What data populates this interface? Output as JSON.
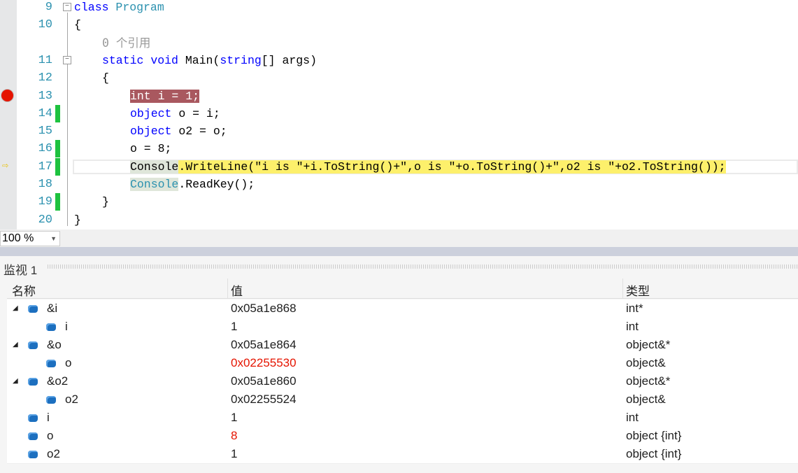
{
  "editor": {
    "lines": [
      {
        "num": "9",
        "tokens": [
          {
            "t": "class ",
            "c": "kw"
          },
          {
            "t": "Program",
            "c": "ty"
          }
        ],
        "indent": 1,
        "fold": true
      },
      {
        "num": "10",
        "tokens": [
          {
            "t": "{"
          }
        ],
        "indent": 1
      },
      {
        "num": "",
        "tokens": [
          {
            "t": "0 个引用",
            "c": "cl"
          }
        ],
        "indent": 2
      },
      {
        "num": "11",
        "tokens": [
          {
            "t": "static ",
            "c": "kw"
          },
          {
            "t": "void ",
            "c": "kw"
          },
          {
            "t": "Main("
          },
          {
            "t": "string",
            "c": "kw"
          },
          {
            "t": "[] args)"
          }
        ],
        "indent": 2,
        "fold": true
      },
      {
        "num": "12",
        "tokens": [
          {
            "t": "{"
          }
        ],
        "indent": 2
      },
      {
        "num": "13",
        "tokens": [
          {
            "t": "int i = 1;",
            "c": "hl-bp"
          }
        ],
        "indent": 3,
        "breakpoint": true
      },
      {
        "num": "14",
        "tokens": [
          {
            "t": "object",
            "c": "kw"
          },
          {
            "t": " o = i;"
          }
        ],
        "indent": 3,
        "changed": true
      },
      {
        "num": "15",
        "tokens": [
          {
            "t": "object",
            "c": "kw"
          },
          {
            "t": " o2 = o;"
          }
        ],
        "indent": 3
      },
      {
        "num": "16",
        "tokens": [
          {
            "t": "o = 8;"
          }
        ],
        "indent": 3,
        "changed": true
      },
      {
        "num": "17",
        "tokens": [
          {
            "t": "Console",
            "c": "hl-con"
          },
          {
            "t": ".WriteLine(\"i is \"+i.ToString()+\",o is \"+o.ToString()+\",o2 is \"+o2.ToString());",
            "c": "hl-cur"
          }
        ],
        "indent": 3,
        "changed": true,
        "current": true
      },
      {
        "num": "18",
        "tokens": [
          {
            "t": "Console",
            "c": "ty hl-con"
          },
          {
            "t": ".ReadKey();"
          }
        ],
        "indent": 3
      },
      {
        "num": "19",
        "tokens": [
          {
            "t": "}"
          }
        ],
        "indent": 2,
        "changed": true
      },
      {
        "num": "20",
        "tokens": [
          {
            "t": "}"
          }
        ],
        "indent": 1
      }
    ],
    "zoom": "100 %"
  },
  "watch": {
    "title": "监视 1",
    "headers": {
      "name": "名称",
      "value": "值",
      "type": "类型"
    },
    "rows": [
      {
        "name": "&i",
        "value": "0x05a1e868",
        "type": "int*",
        "level": 0,
        "expanded": true
      },
      {
        "name": "i",
        "value": "1",
        "type": "int",
        "level": 1
      },
      {
        "name": "&o",
        "value": "0x05a1e864",
        "type": "object&*",
        "level": 0,
        "expanded": true
      },
      {
        "name": "o",
        "value": "0x02255530",
        "type": "object&",
        "level": 1,
        "changed": true
      },
      {
        "name": "&o2",
        "value": "0x05a1e860",
        "type": "object&*",
        "level": 0,
        "expanded": true
      },
      {
        "name": "o2",
        "value": "0x02255524",
        "type": "object&",
        "level": 1
      },
      {
        "name": "i",
        "value": "1",
        "type": "int",
        "level": 0
      },
      {
        "name": "o",
        "value": "8",
        "type": "object {int}",
        "level": 0,
        "changed": true
      },
      {
        "name": "o2",
        "value": "1",
        "type": "object {int}",
        "level": 0
      }
    ]
  }
}
